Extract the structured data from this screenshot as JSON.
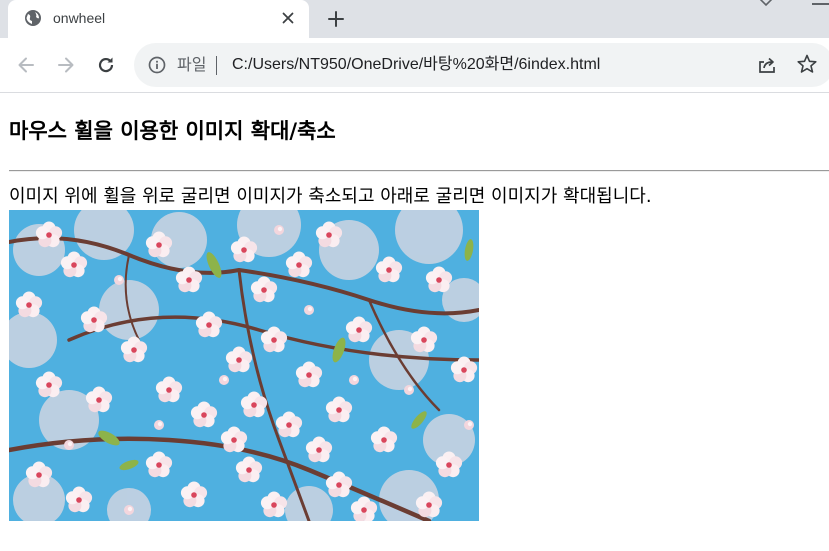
{
  "tab": {
    "title": "onwheel",
    "favicon": "globe-icon",
    "close_icon": "close-icon"
  },
  "tabstrip": {
    "new_tab_icon": "plus-icon",
    "tab_search_icon": "chevron-down-icon"
  },
  "toolbar": {
    "back_icon": "arrow-left-icon",
    "forward_icon": "arrow-right-icon",
    "reload_icon": "reload-icon",
    "info_icon": "info-icon",
    "scheme_label": "파일",
    "url": "C:/Users/NT950/OneDrive/바탕%20화면/6index.html",
    "share_icon": "share-icon",
    "bookmark_icon": "star-icon"
  },
  "page": {
    "heading": "마우스 휠을 이용한 이미지 확대/축소",
    "description": "이미지 위에 휠을 위로 굴리면 이미지가 축소되고 아래로 굴리면 이미지가 확대됩니다.",
    "image_subject": "cherry blossoms against blue sky"
  },
  "colors": {
    "tabstrip_bg": "#dee1e6",
    "omnibox_bg": "#f1f3f4",
    "sky": "#4fb0e0",
    "blossom": "#f7e6ea",
    "blossom_center": "#d9465c",
    "branch": "#6b3d33",
    "leaf": "#8db34a"
  }
}
